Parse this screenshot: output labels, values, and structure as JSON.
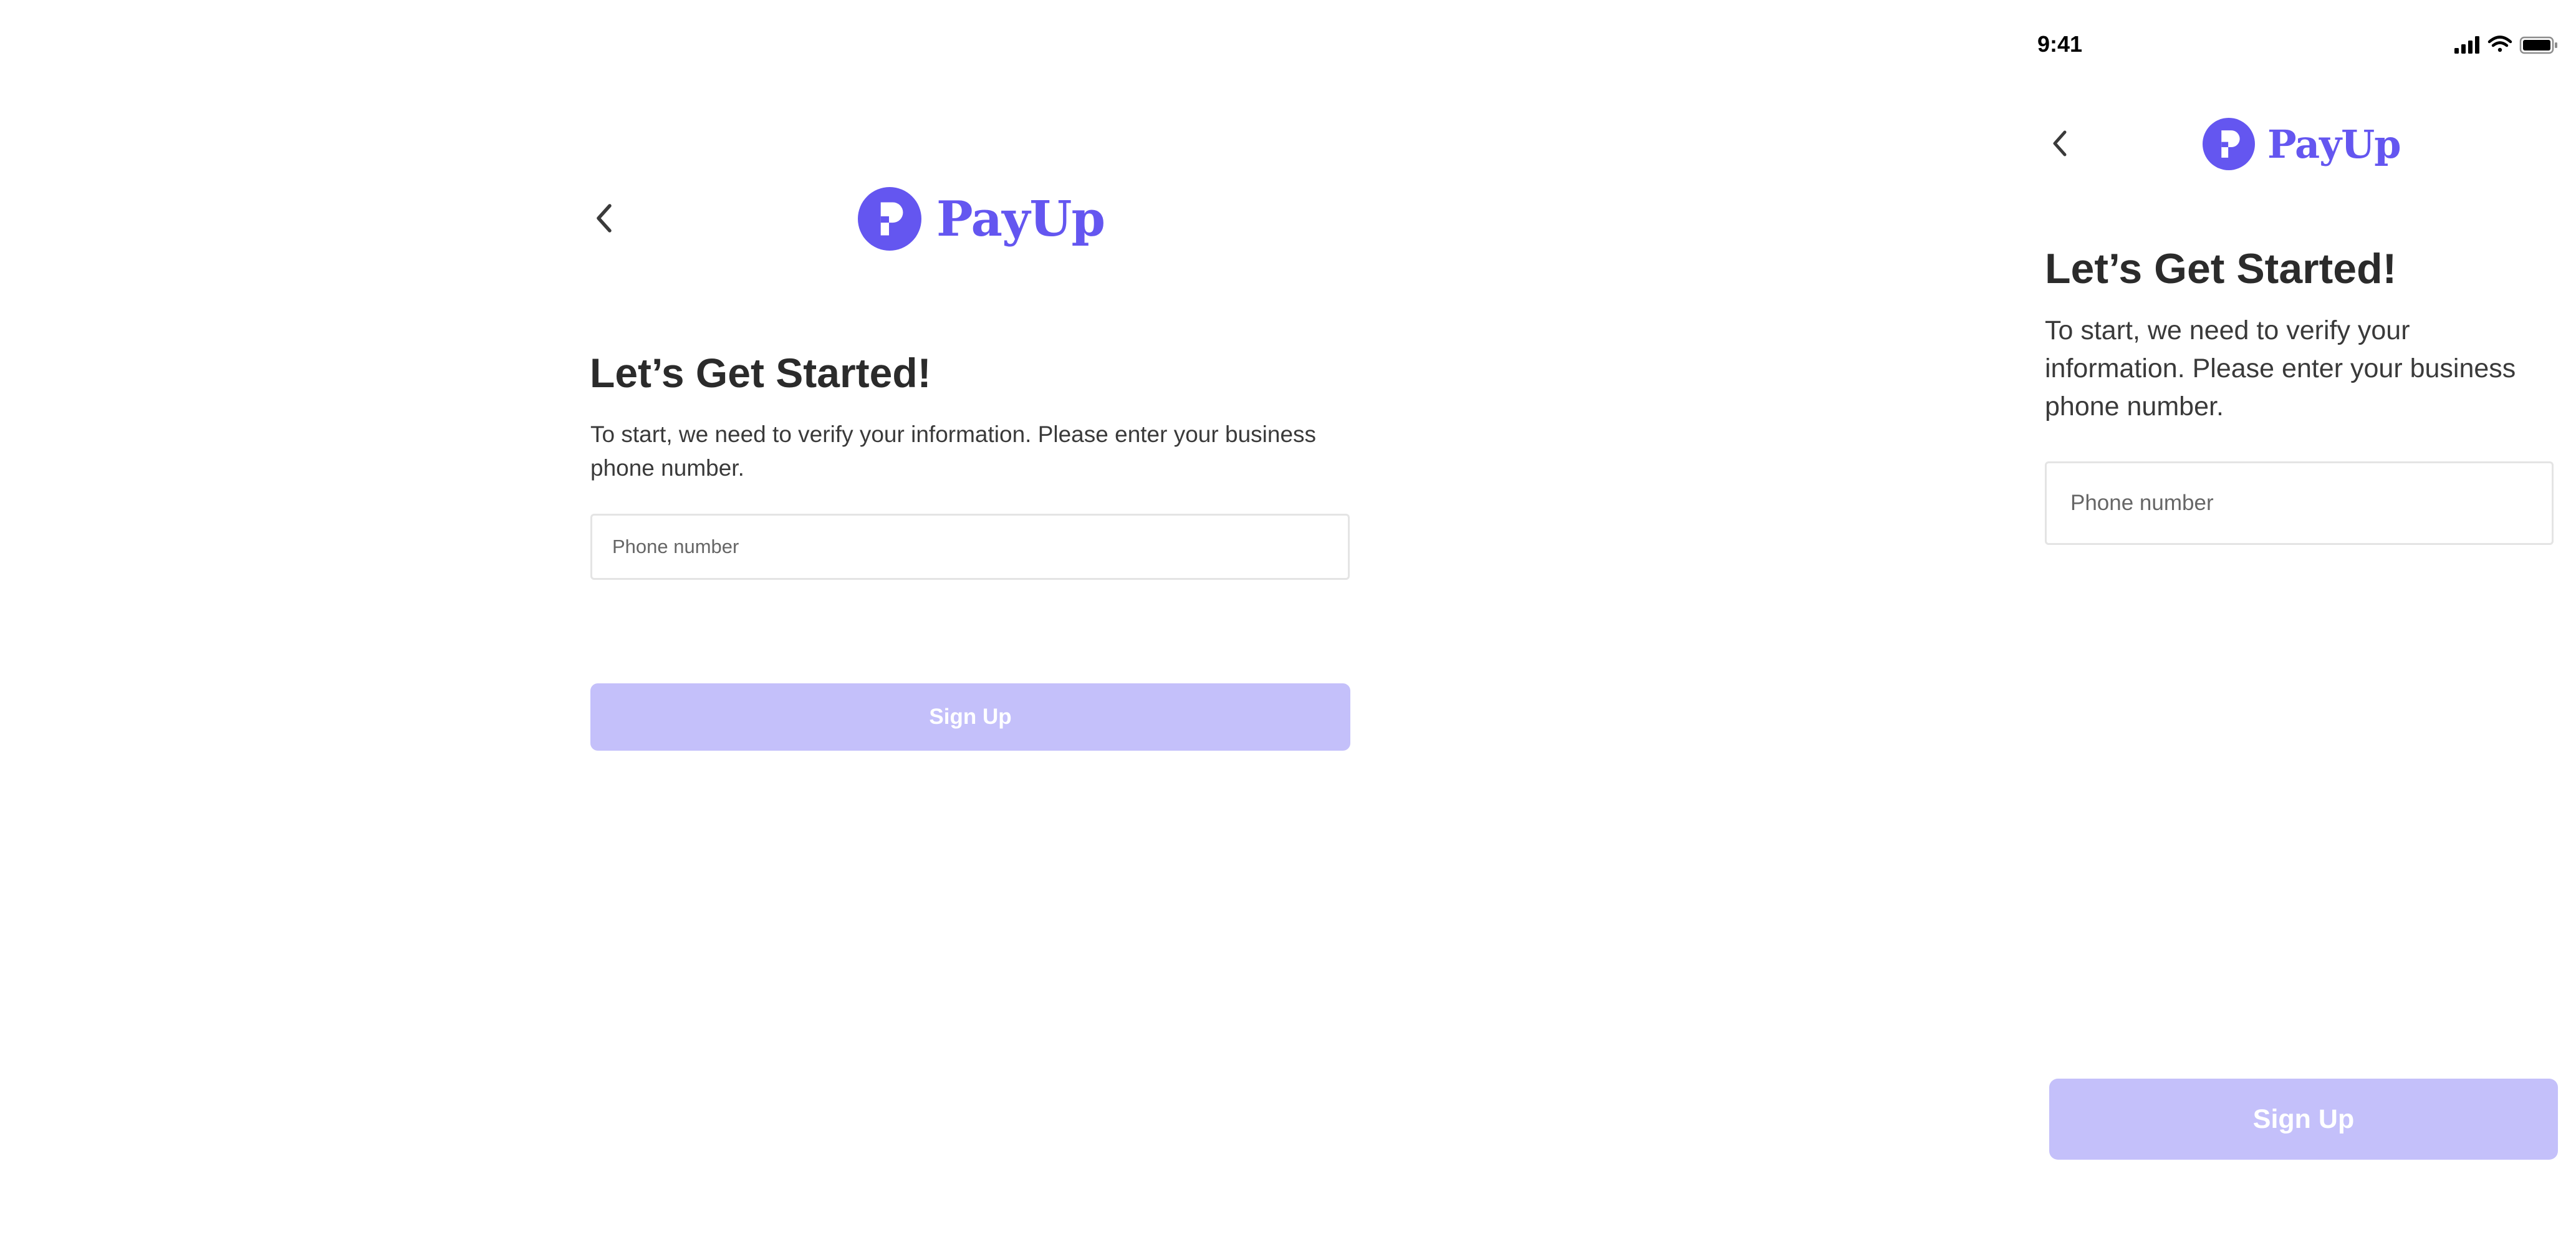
{
  "brand": {
    "name": "PayUp",
    "logo_icon": "payup-logo-icon",
    "color": "#6456F0"
  },
  "colors": {
    "button_disabled": "#C4C0FA",
    "button_text": "#FFFFFF",
    "input_border": "#E4E4E4"
  },
  "desktop": {
    "back_icon": "chevron-left-icon",
    "title": "Let’s Get Started!",
    "description": "To start, we need to verify your information. Please enter your business phone number.",
    "phone_placeholder": "Phone number",
    "signup_label": "Sign Up",
    "signup_state": "disabled"
  },
  "mobile": {
    "status_bar": {
      "time": "9:41",
      "icons": [
        "cellular-signal-icon",
        "wifi-icon",
        "battery-icon"
      ]
    },
    "back_icon": "chevron-left-icon",
    "title": "Let’s Get Started!",
    "description": "To start, we need to verify your information. Please enter your business phone number.",
    "phone_placeholder": "Phone number",
    "signup_label": "Sign Up",
    "signup_state": "disabled"
  }
}
